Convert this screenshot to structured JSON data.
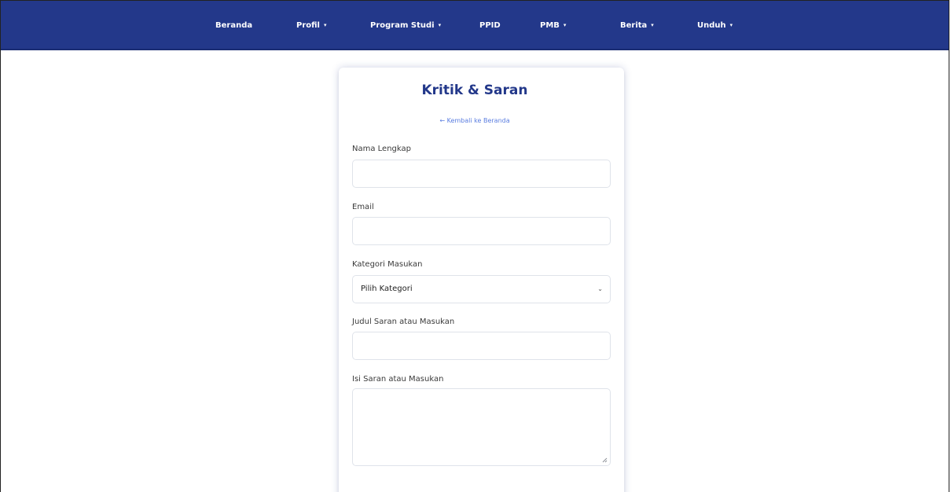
{
  "navbar": {
    "items": [
      {
        "label": "Beranda",
        "dropdown": false
      },
      {
        "label": "Profil",
        "dropdown": true
      },
      {
        "label": "Program Studi",
        "dropdown": true
      },
      {
        "label": "PPID",
        "dropdown": false
      },
      {
        "label": "PMB",
        "dropdown": true
      },
      {
        "label": "Berita",
        "dropdown": true
      },
      {
        "label": "Unduh",
        "dropdown": true
      }
    ],
    "caret": "▾"
  },
  "form": {
    "title": "Kritik & Saran",
    "back_link": "← Kembali ke Beranda",
    "fields": {
      "name_label": "Nama Lengkap",
      "email_label": "Email",
      "category_label": "Kategori Masukan",
      "category_selected": "Pilih Kategori",
      "subject_label": "Judul Saran atau Masukan",
      "message_label": "Isi Saran atau Masukan"
    }
  },
  "colors": {
    "primary": "#23388a",
    "link": "#5a7de0",
    "border": "#dfe3ea"
  },
  "icons": {
    "select_arrow": "chevron-down-icon",
    "resize_handle": "resize-handle-icon"
  }
}
